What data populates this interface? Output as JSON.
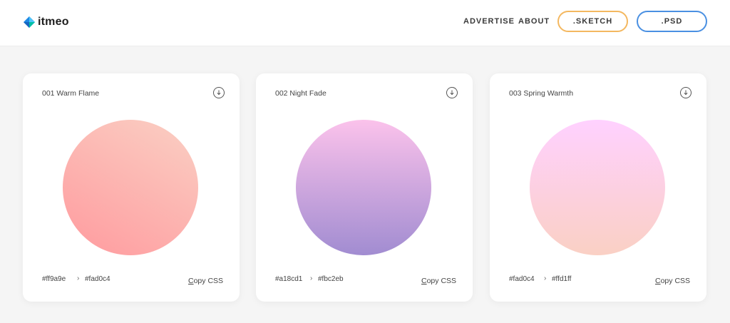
{
  "header": {
    "logo_text": "itmeo",
    "nav": {
      "advertise": "ADVERTISE",
      "about": "ABOUT"
    },
    "buttons": {
      "sketch": ".SKETCH",
      "psd": ".PSD"
    },
    "colors": {
      "sketch_border": "#f4b860",
      "psd_border": "#4a90e2"
    }
  },
  "gradients": [
    {
      "title": "001 Warm Flame",
      "from": "#ff9a9e",
      "arrow": "›",
      "to": "#fad0c4",
      "copy_first": "C",
      "copy_rest": "opy CSS"
    },
    {
      "title": "002 Night Fade",
      "from": "#a18cd1",
      "arrow": "›",
      "to": "#fbc2eb",
      "copy_first": "C",
      "copy_rest": "opy CSS"
    },
    {
      "title": "003 Spring Warmth",
      "from": "#fad0c4",
      "arrow": "›",
      "to": "#ffd1ff",
      "copy_first": "C",
      "copy_rest": "opy CSS"
    }
  ]
}
